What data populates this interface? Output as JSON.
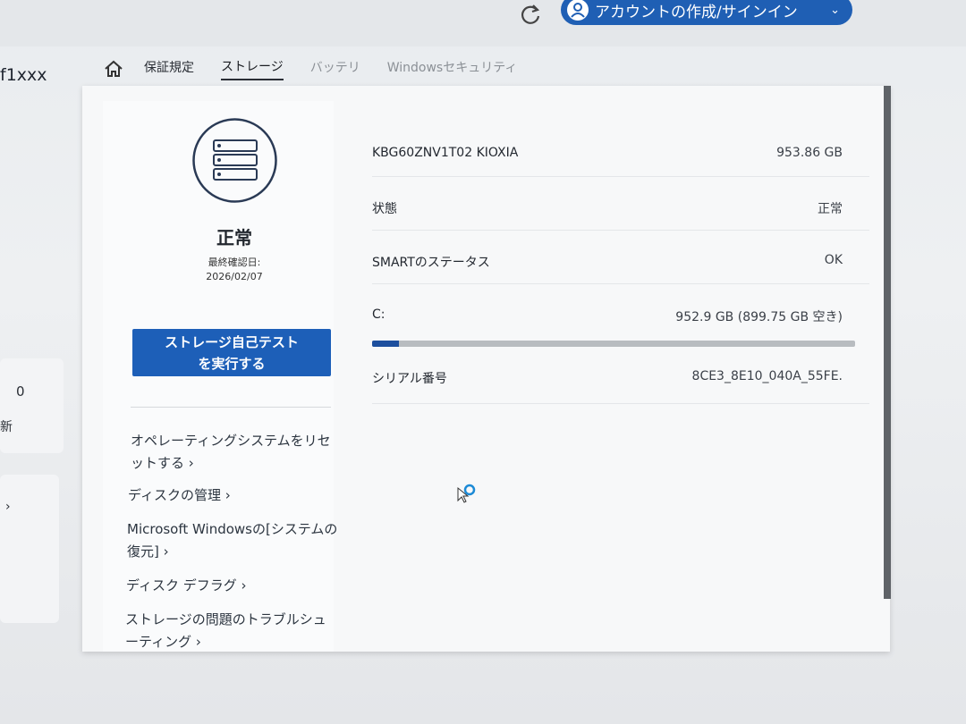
{
  "header": {
    "account_label": "アカウントの作成/サインイン",
    "device_name": "f1xxx"
  },
  "tabs": [
    {
      "label": "保証規定"
    },
    {
      "label": "ストレージ"
    },
    {
      "label": "バッテリ"
    },
    {
      "label": "Windowsセキュリティ"
    }
  ],
  "left_cards": {
    "count": "0",
    "label": "新"
  },
  "storage": {
    "status": "正常",
    "last_checked_label": "最終確認日:",
    "last_checked_date": "2026/02/07",
    "selftest_line1": "ストレージ自己テスト",
    "selftest_line2": "を実行する",
    "links": {
      "reset_os_l1": "オペレーティングシステムをリセ",
      "reset_os_l2": "ットする ›",
      "disk_mgmt": "ディスクの管理 ›",
      "restore_l1": "Microsoft Windowsの[システムの",
      "restore_l2": "復元] ›",
      "defrag": "ディスク デフラグ ›",
      "troubleshoot_l1": "ストレージの問題のトラブルシュ",
      "troubleshoot_l2": "ーティング ›"
    },
    "info": {
      "model": "KBG60ZNV1T02 KIOXIA",
      "capacity": "953.86 GB",
      "state_label": "状態",
      "state_value": "正常",
      "smart_label": "SMARTのステータス",
      "smart_value": "OK",
      "drive_label": "C:",
      "drive_value": "952.9 GB (899.75 GB 空き)",
      "drive_used_fraction": 0.056,
      "serial_label": "シリアル番号",
      "serial_value": "8CE3_8E10_040A_55FE."
    }
  },
  "colors": {
    "accent": "#1d5fb8",
    "progress_fill": "#1d4f9e"
  }
}
